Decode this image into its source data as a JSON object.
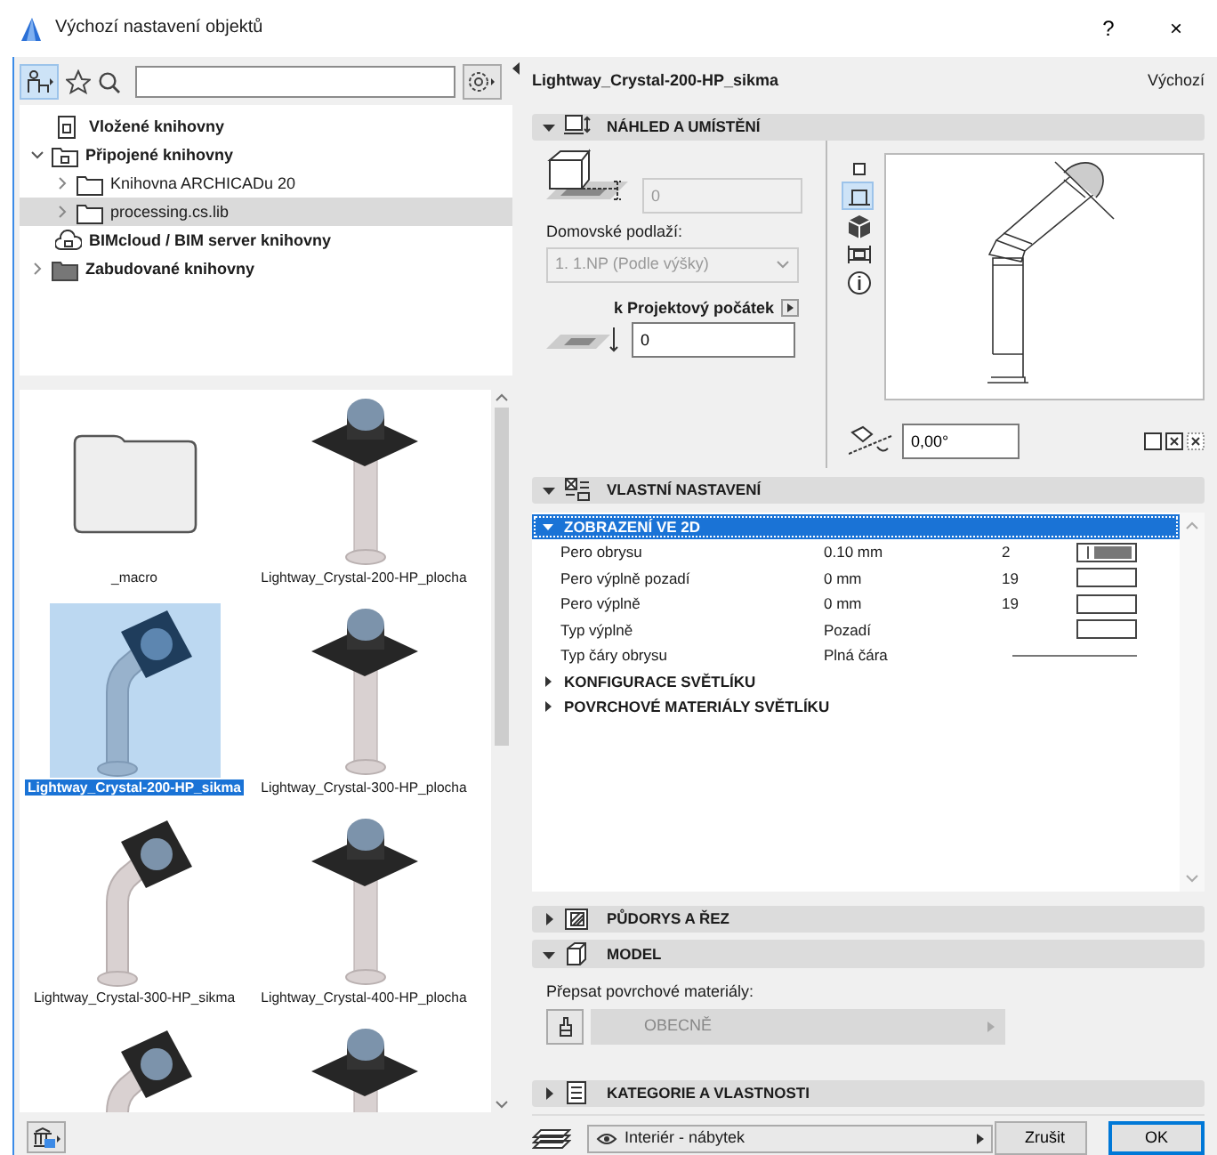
{
  "window": {
    "title": "Výchozí nastavení objektů",
    "help": "?",
    "close": "×"
  },
  "library": {
    "tree": [
      {
        "label": "Vložené knihovny",
        "kind": "embedded",
        "expandable": false,
        "selected": false
      },
      {
        "label": "Připojené knihovny",
        "kind": "linked",
        "expandable": true,
        "expanded": true,
        "selected": false,
        "children": [
          {
            "label": "Knihovna ARCHICADu 20",
            "kind": "folder",
            "expandable": true,
            "expanded": false,
            "selected": false
          },
          {
            "label": "processing.cs.lib",
            "kind": "folder",
            "expandable": true,
            "expanded": false,
            "selected": true
          }
        ]
      },
      {
        "label": "BIMcloud / BIM server knihovny",
        "kind": "cloud",
        "expandable": false,
        "selected": false
      },
      {
        "label": "Zabudované knihovny",
        "kind": "builtin",
        "expandable": true,
        "expanded": false,
        "selected": false
      }
    ],
    "thumbnails": [
      {
        "label": "_macro",
        "kind": "folder",
        "selected": false
      },
      {
        "label": "Lightway_Crystal-200-HP_plocha",
        "kind": "flat",
        "selected": false
      },
      {
        "label": "Lightway_Crystal-200-HP_sikma",
        "kind": "sloped",
        "selected": true
      },
      {
        "label": "Lightway_Crystal-300-HP_plocha",
        "kind": "flat",
        "selected": false
      },
      {
        "label": "Lightway_Crystal-300-HP_sikma",
        "kind": "sloped",
        "selected": false
      },
      {
        "label": "Lightway_Crystal-400-HP_plocha",
        "kind": "flat",
        "selected": false
      },
      {
        "kind": "sloped",
        "selected": false
      },
      {
        "kind": "flat",
        "selected": false
      }
    ]
  },
  "object": {
    "name": "Lightway_Crystal-200-HP_sikma",
    "preset": "Výchozí"
  },
  "sections": [
    {
      "kind": "preview",
      "title": "NÁHLED A UMÍSTĚNÍ",
      "expanded": true,
      "height": {
        "value": "0",
        "disabled": true
      },
      "story": {
        "label": "Domovské podlaží:",
        "value": "1. 1.NP (Podle výšky)",
        "disabled": true
      },
      "offset": {
        "label": "k Projektový počátek",
        "value": "0"
      },
      "views": [
        {
          "selected": false
        },
        {
          "selected": true
        },
        {
          "selected": false
        },
        {
          "selected": false
        },
        {
          "selected": false
        }
      ],
      "angle": "0,00°"
    },
    {
      "kind": "custom",
      "title": "VLASTNÍ NASTAVENÍ",
      "expanded": true,
      "groups": [
        {
          "title": "ZOBRAZENÍ VE 2D",
          "expanded": true,
          "selected": true,
          "rows": [
            {
              "name": "Pero obrysu",
              "value": "0.10 mm",
              "pen": "2",
              "kind": "pen"
            },
            {
              "name": "Pero výplně pozadí",
              "value": "0 mm",
              "pen": "19",
              "kind": "fill"
            },
            {
              "name": "Pero výplně",
              "value": "0 mm",
              "pen": "19",
              "kind": "fill"
            },
            {
              "name": "Typ výplně",
              "value": "Pozadí",
              "kind": "fill"
            },
            {
              "name": "Typ čáry obrysu",
              "value": "Plná čára",
              "kind": "line"
            }
          ]
        },
        {
          "title": "KONFIGURACE SVĚTLÍKU",
          "expanded": false,
          "selected": false
        },
        {
          "title": "POVRCHOVÉ MATERIÁLY SVĚTLÍKU",
          "expanded": false,
          "selected": false
        }
      ]
    },
    {
      "kind": "floorplan",
      "title": "PŮDORYS A ŘEZ",
      "expanded": false
    },
    {
      "kind": "model",
      "title": "MODEL",
      "expanded": true,
      "label": "Přepsat povrchové materiály:",
      "material": "OBECNĚ",
      "disabled": true
    },
    {
      "kind": "category",
      "title": "KATEGORIE A VLASTNOSTI",
      "expanded": false
    }
  ],
  "footer": {
    "layer": "Interiér - nábytek",
    "buttons": [
      {
        "label": "Zrušit",
        "default": false
      },
      {
        "label": "OK",
        "default": true
      }
    ]
  }
}
